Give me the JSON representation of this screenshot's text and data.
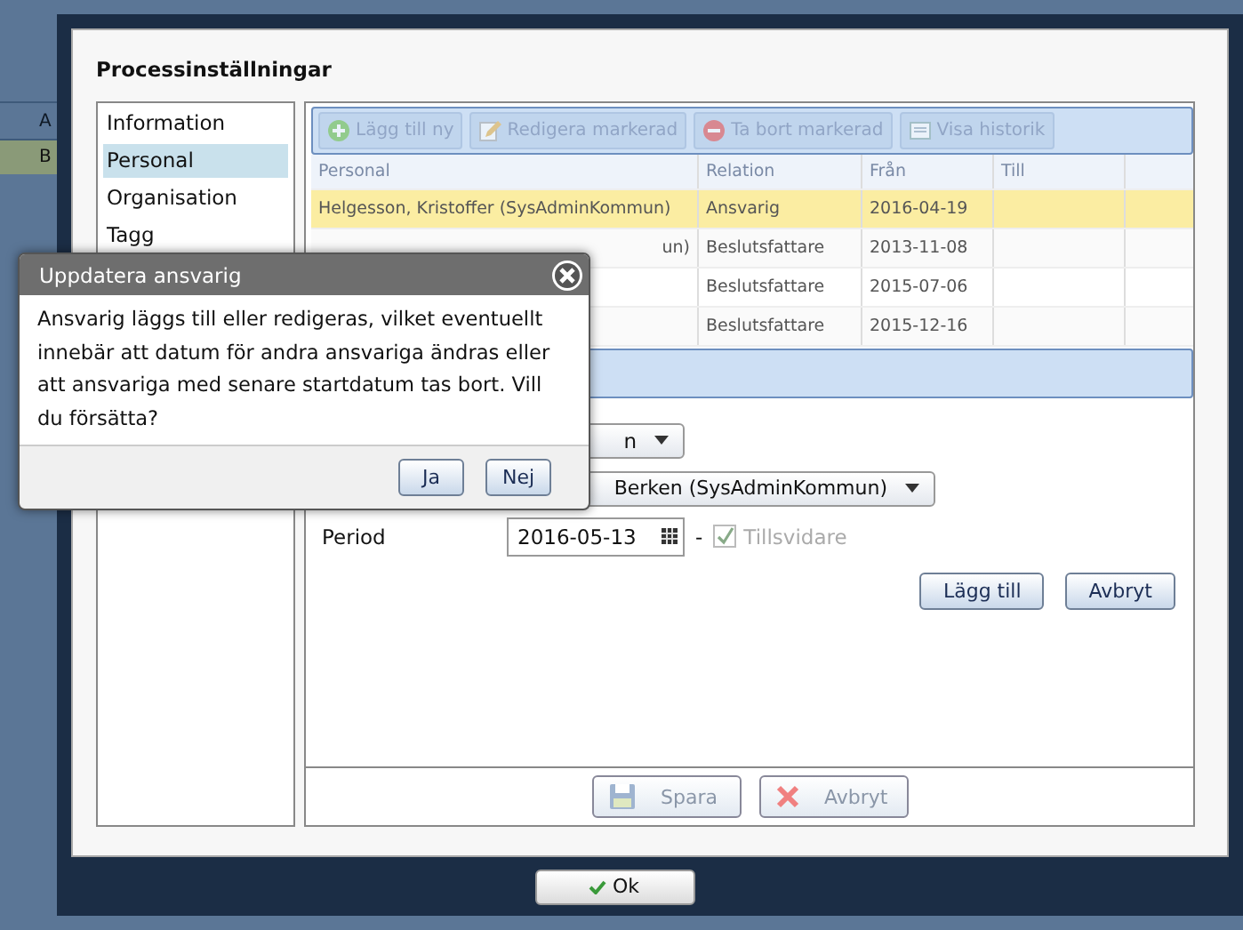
{
  "background_page": {
    "column_header": "A",
    "row_cell": "B"
  },
  "window": {
    "title": "Processinställningar",
    "ok_button": "Ok"
  },
  "sidebar": {
    "items": [
      {
        "label": "Information",
        "selected": false
      },
      {
        "label": "Personal",
        "selected": true
      },
      {
        "label": "Organisation",
        "selected": false
      },
      {
        "label": "Tagg",
        "selected": false
      }
    ]
  },
  "toolbar": {
    "buttons": [
      {
        "label": "Lägg till ny",
        "kind": "add",
        "disabled": true
      },
      {
        "label": "Redigera markerad",
        "kind": "edit",
        "disabled": true
      },
      {
        "label": "Ta bort markerad",
        "kind": "delete",
        "disabled": true
      },
      {
        "label": "Visa historik",
        "kind": "history",
        "disabled": true
      }
    ]
  },
  "table": {
    "columns": [
      "Personal",
      "Relation",
      "Från",
      "Till"
    ],
    "rows": [
      {
        "personal": "Helgesson, Kristoffer (SysAdminKommun)",
        "relation": "Ansvarig",
        "from": "2016-04-19",
        "selected": true
      },
      {
        "personal": "un)",
        "relation": "Beslutsfattare",
        "from": "2013-11-08",
        "selected": false
      },
      {
        "relation": "Beslutsfattare",
        "from": "2015-07-06",
        "selected": false
      },
      {
        "relation": "Beslutsfattare",
        "from": "2015-12-16",
        "selected": false
      }
    ]
  },
  "form": {
    "role_dropdown": "n",
    "person_dropdown": "Berken (SysAdminKommun)",
    "period_label": "Period",
    "start_date": "2016-05-13",
    "range_separator": "-",
    "until_further_notice": {
      "label": "Tillsvidare",
      "checked": true,
      "disabled": true
    },
    "add_button": "Lägg till",
    "cancel_button": "Avbryt"
  },
  "footer_buttons": [
    {
      "label": "Spara",
      "kind": "save",
      "disabled": true
    },
    {
      "label": "Avbryt",
      "kind": "cancel",
      "disabled": true
    }
  ],
  "dialog": {
    "title": "Uppdatera ansvarig",
    "message": "Ansvarig läggs till eller redigeras, vilket eventuellt innebär att datum för andra ansvariga ändras eller att ansvariga med senare startdatum tas bort. Vill du försätta?",
    "buttons": [
      "Ja",
      "Nej"
    ]
  }
}
